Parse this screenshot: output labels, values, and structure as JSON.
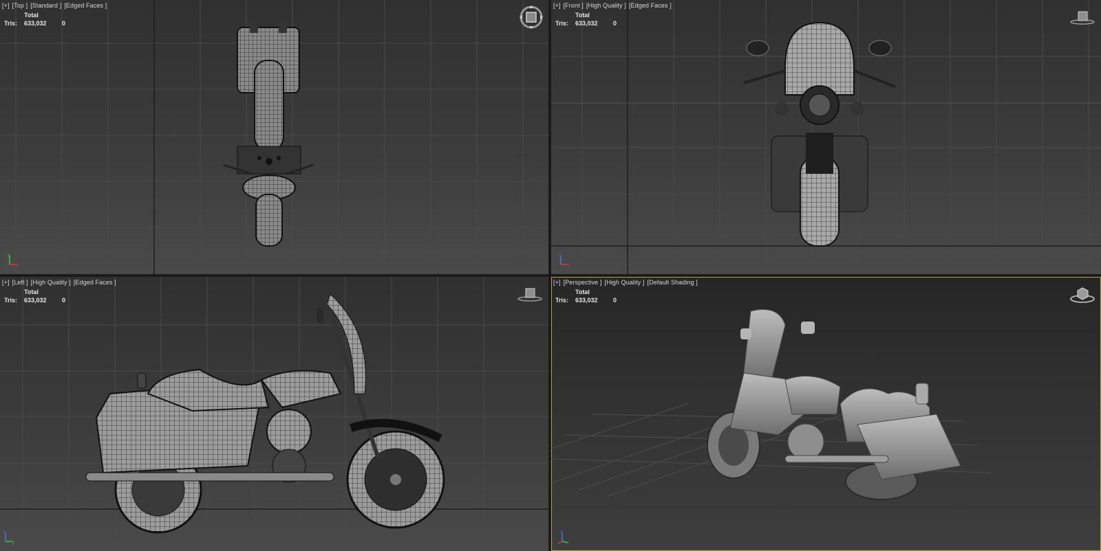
{
  "stats": {
    "header": "Total",
    "label": "Tris:",
    "total": "633,032",
    "selected": "0"
  },
  "viewports": {
    "top": {
      "plus": "[+]",
      "view": "[Top ]",
      "shading": "[Standard ]",
      "edges": "[Edged Faces ]"
    },
    "front": {
      "plus": "[+]",
      "view": "[Front ]",
      "shading": "[High Quality ]",
      "edges": "[Edged Faces ]"
    },
    "left": {
      "plus": "[+]",
      "view": "[Left ]",
      "shading": "[High Quality ]",
      "edges": "[Edged Faces ]"
    },
    "persp": {
      "plus": "[+]",
      "view": "[Perspective ]",
      "shading": "[High Quality ]",
      "edges": "[Default Shading ]"
    }
  },
  "axis": {
    "x": "x",
    "y": "y",
    "z": "z"
  },
  "colors": {
    "active_border": "#b8a24e",
    "axis_x": "#d23c3c",
    "axis_y": "#3cc83c",
    "axis_z": "#4a74e0"
  }
}
